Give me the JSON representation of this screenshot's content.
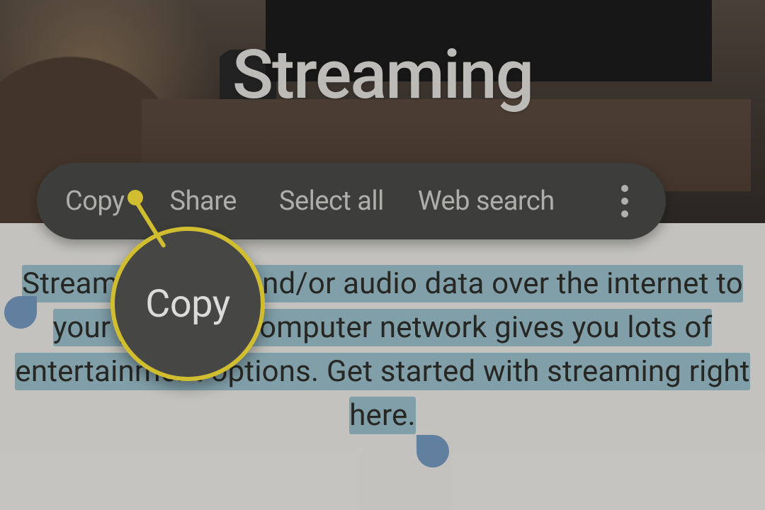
{
  "hero": {
    "title": "Streaming"
  },
  "selection": {
    "paragraph": "Streaming video and/or audio data over the internet to your phone or computer network gives you lots of entertainment options. Get started with streaming right here."
  },
  "context_menu": {
    "items": {
      "copy": "Copy",
      "share": "Share",
      "select_all": "Select all",
      "web_search": "Web search"
    }
  },
  "callout": {
    "label": "Copy",
    "target": "copy-menu-item"
  },
  "colors": {
    "highlight_yellow": "#f2db2f",
    "selection_bg": "#91b6c2",
    "handle_blue": "#6b8fb5",
    "menu_bg": "#3f3f3d"
  }
}
